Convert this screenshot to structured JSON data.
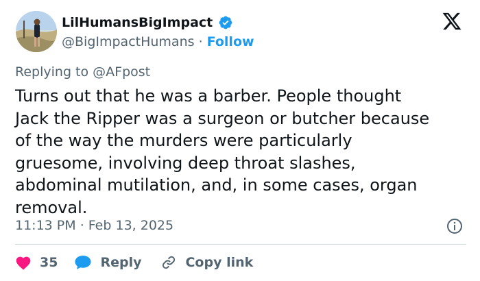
{
  "author": {
    "display_name": "LilHumansBigImpact",
    "handle": "@BigImpactHumans",
    "separator": "·",
    "follow_label": "Follow"
  },
  "reply": {
    "prefix": "Replying to",
    "handle": "@AFpost"
  },
  "tweet": {
    "text": "Turns out that he was a barber. People thought\nJack the Ripper was a surgeon or butcher because\nof the way the murders were particularly\ngruesome, involving deep throat slashes,\nabdominal mutilation, and, in some cases, organ\nremoval.",
    "time": "11:13 PM",
    "separator": "·",
    "date": "Feb 13, 2025"
  },
  "actions": {
    "like_count": "35",
    "reply_label": "Reply",
    "copy_link_label": "Copy link"
  },
  "colors": {
    "accent": "#1d9bf0",
    "like": "#f91880",
    "secondary_text": "#536471",
    "divider": "#cfd9de"
  },
  "icons": {
    "brand": "x-logo-icon",
    "verified": "verified-badge-icon",
    "info": "info-icon",
    "like": "heart-icon",
    "reply": "reply-bubble-icon",
    "copy_link": "link-icon"
  }
}
